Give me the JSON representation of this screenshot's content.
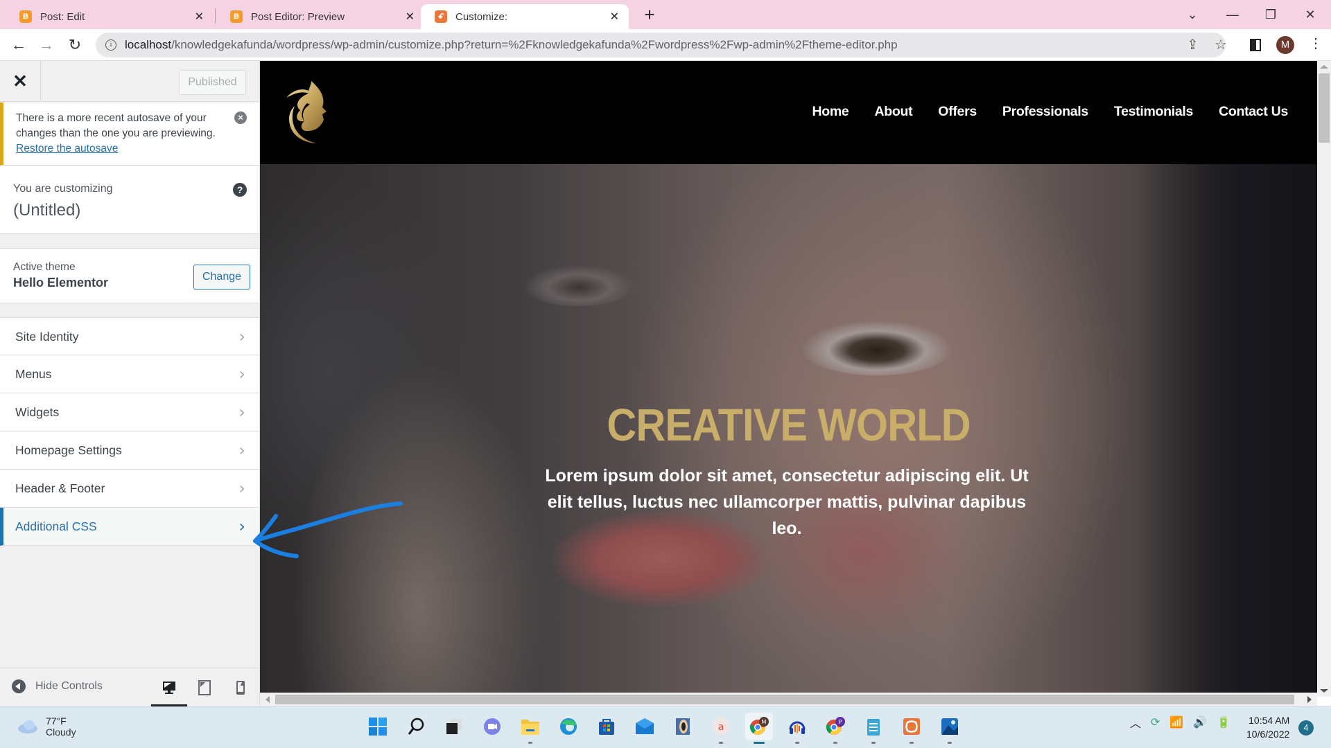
{
  "browser": {
    "tabs": [
      {
        "title": "Post: Edit",
        "icon": "blogger-icon",
        "active": false
      },
      {
        "title": "Post Editor: Preview",
        "icon": "blogger-icon",
        "active": false
      },
      {
        "title": "Customize:",
        "icon": "xampp-icon",
        "active": true
      }
    ],
    "close_glyph": "✕",
    "new_tab_glyph": "+",
    "url_host": "localhost",
    "url_path": "/knowledgekafunda/wordpress/wp-admin/customize.php?return=%2Fknowledgekafunda%2Fwordpress%2Fwp-admin%2Ftheme-editor.php",
    "profile_initial": "M"
  },
  "customizer": {
    "close_glyph": "✕",
    "publish_label": "Published",
    "notice": {
      "text": "There is a more recent autosave of your changes than the one you are previewing.",
      "link": "Restore the autosave"
    },
    "customizing_label": "You are customizing",
    "site_title": "(Untitled)",
    "active_theme_label": "Active theme",
    "active_theme_name": "Hello Elementor",
    "change_label": "Change",
    "sections": [
      {
        "label": "Site Identity",
        "active": false
      },
      {
        "label": "Menus",
        "active": false
      },
      {
        "label": "Widgets",
        "active": false
      },
      {
        "label": "Homepage Settings",
        "active": false
      },
      {
        "label": "Header & Footer",
        "active": false
      },
      {
        "label": "Additional CSS",
        "active": true
      }
    ],
    "hide_controls_label": "Hide Controls",
    "devices": [
      "desktop",
      "tablet",
      "mobile"
    ],
    "active_device": "desktop"
  },
  "preview": {
    "nav": [
      "Home",
      "About",
      "Offers",
      "Professionals",
      "Testimonials",
      "Contact Us"
    ],
    "hero_title": "CREATIVE WORLD",
    "hero_text": "Lorem ipsum dolor sit amet, consectetur adipiscing elit. Ut elit tellus, luctus nec ullamcorper mattis, pulvinar dapibus leo.",
    "colors": {
      "hero_title": "#c9ae6a",
      "header_bg": "#000000",
      "annotation_arrow": "#1a7fe0"
    }
  },
  "taskbar": {
    "weather_temp": "77°F",
    "weather_condition": "Cloudy",
    "apps": [
      "start",
      "search",
      "task-view",
      "teams-chat",
      "file-explorer",
      "edge",
      "microsoft-store",
      "mail",
      "media-player",
      "app-a",
      "chrome-m",
      "audacity",
      "chrome-p",
      "notepad",
      "xampp",
      "photos"
    ],
    "time": "10:54 AM",
    "date": "10/6/2022",
    "notification_count": "4"
  }
}
